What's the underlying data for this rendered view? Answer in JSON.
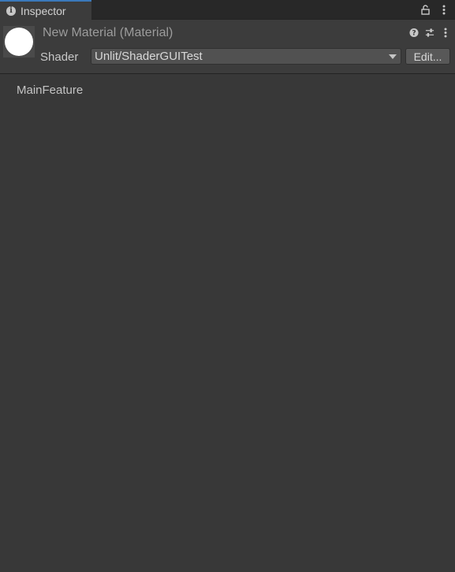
{
  "tab": {
    "label": "Inspector",
    "icon": "info-icon",
    "icon_glyph": "i"
  },
  "tab_tools": [
    "lock-icon",
    "kebab-menu-icon"
  ],
  "header": {
    "title": "New Material (Material)",
    "preview": "material-preview-sphere",
    "icons": [
      "help-icon",
      "preset-icon",
      "kebab-menu-icon"
    ]
  },
  "shader": {
    "label": "Shader",
    "value": "Unlit/ShaderGUITest",
    "edit_label": "Edit..."
  },
  "body": {
    "feature_label": "MainFeature"
  },
  "colors": {
    "background": "#383838",
    "tab_accent": "#3a79bb",
    "preview_sphere": "#ffffff"
  }
}
